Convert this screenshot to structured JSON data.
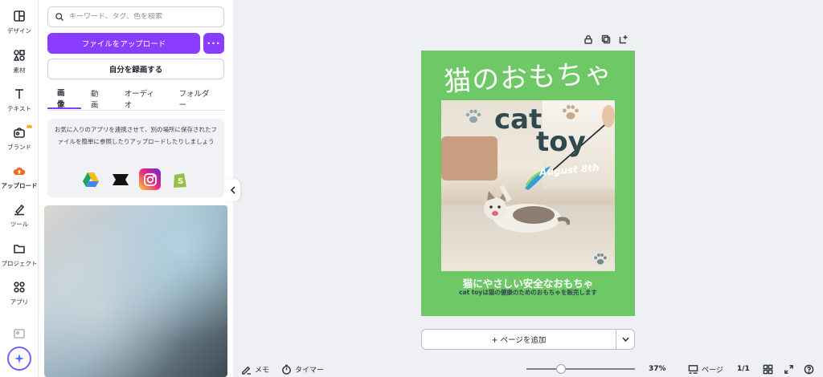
{
  "rail": {
    "items": [
      {
        "label": "デザイン",
        "icon": "layout-icon"
      },
      {
        "label": "素材",
        "icon": "shapes-icon"
      },
      {
        "label": "テキスト",
        "icon": "text-icon"
      },
      {
        "label": "ブランド",
        "icon": "brand-icon"
      },
      {
        "label": "アップロード",
        "icon": "upload-cloud-icon"
      },
      {
        "label": "ツール",
        "icon": "draw-icon"
      },
      {
        "label": "プロジェクト",
        "icon": "folder-icon"
      },
      {
        "label": "アプリ",
        "icon": "apps-icon"
      }
    ]
  },
  "panel": {
    "search_placeholder": "キーワード、タグ、色を検索",
    "upload_label": "ファイルをアップロード",
    "more_label": "•••",
    "record_label": "自分を録画する",
    "tabs": [
      {
        "label": "画像"
      },
      {
        "label": "動画"
      },
      {
        "label": "オーディオ"
      },
      {
        "label": "フォルダー"
      }
    ],
    "promo_text": "お気に入りのアプリを連携させて、別の場所に保存されたファイルを簡単に参照したりアップロードしたりしましょう",
    "apps": [
      "google-drive-icon",
      "dropbox-icon",
      "instagram-icon",
      "shopify-icon"
    ]
  },
  "design": {
    "title": "猫のおもちゃ",
    "word1": "cat",
    "word2": "toy",
    "date": "August 8th",
    "subtitle": "猫にやさしい安全なおもちゃ",
    "caption": "cat toyは猫の健康のためのおもちゃを販売します",
    "bg_color": "#6ec865"
  },
  "add_page_label": "+ ページを追加",
  "bottom": {
    "notes_label": "メモ",
    "timer_label": "タイマー",
    "zoom_value": 37,
    "zoom_label": "37%",
    "pages_label": "ページ",
    "page_count": "1/1"
  },
  "colors": {
    "accent": "#8b3dff"
  }
}
